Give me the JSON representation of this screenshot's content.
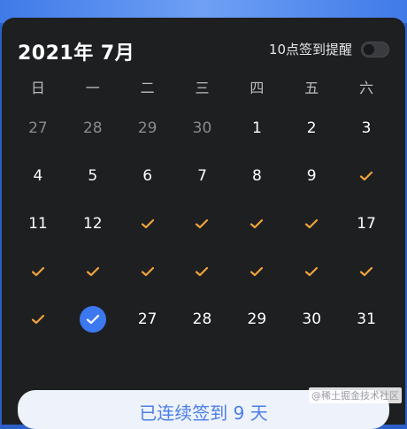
{
  "header": {
    "title": "2021年 7月",
    "reminder_label": "10点签到提醒"
  },
  "colors": {
    "accent": "#3c78f0",
    "check": "#f0a23c",
    "panel": "#1e1f21"
  },
  "calendar": {
    "weekdays": [
      "日",
      "一",
      "二",
      "三",
      "四",
      "五",
      "六"
    ],
    "rows": [
      [
        {
          "label": "27",
          "muted": true
        },
        {
          "label": "28",
          "muted": true
        },
        {
          "label": "29",
          "muted": true
        },
        {
          "label": "30",
          "muted": true
        },
        {
          "label": "1"
        },
        {
          "label": "2"
        },
        {
          "label": "3"
        }
      ],
      [
        {
          "label": "4"
        },
        {
          "label": "5"
        },
        {
          "label": "6"
        },
        {
          "label": "7"
        },
        {
          "label": "8"
        },
        {
          "label": "9"
        },
        {
          "checked": true
        }
      ],
      [
        {
          "label": "11"
        },
        {
          "label": "12"
        },
        {
          "checked": true
        },
        {
          "checked": true
        },
        {
          "checked": true
        },
        {
          "checked": true
        },
        {
          "label": "17"
        }
      ],
      [
        {
          "checked": true
        },
        {
          "checked": true
        },
        {
          "checked": true
        },
        {
          "checked": true
        },
        {
          "checked": true
        },
        {
          "checked": true
        },
        {
          "checked": true
        }
      ],
      [
        {
          "checked": true
        },
        {
          "checked": true,
          "selected": true
        },
        {
          "label": "27"
        },
        {
          "label": "28"
        },
        {
          "label": "29"
        },
        {
          "label": "30"
        },
        {
          "label": "31"
        }
      ]
    ]
  },
  "bottom_button": {
    "label": "已连续签到 9 天"
  },
  "watermark": "@稀土掘金技术社区"
}
